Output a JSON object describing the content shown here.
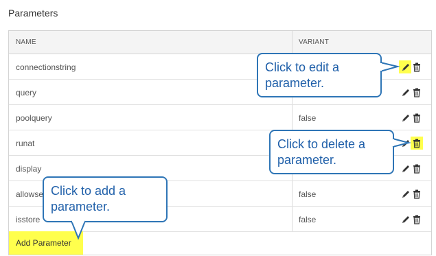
{
  "page": {
    "title": "Parameters"
  },
  "table": {
    "columns": [
      "NAME",
      "VARIANT"
    ],
    "rows": [
      {
        "name": "connectionstring",
        "variant": ""
      },
      {
        "name": "query",
        "variant": ""
      },
      {
        "name": "poolquery",
        "variant": "false"
      },
      {
        "name": "runat",
        "variant": ""
      },
      {
        "name": "display",
        "variant": ""
      },
      {
        "name": "allowse",
        "variant": "false"
      },
      {
        "name": "isstore",
        "variant": "false"
      }
    ],
    "add_label": "Add Parameter"
  },
  "callouts": {
    "edit": "Click to edit a parameter.",
    "delete": "Click to delete a parameter.",
    "add": "Click to add a parameter."
  },
  "colors": {
    "highlight": "#ffff4d",
    "callout_border": "#2e75b6",
    "callout_text": "#1f5fa9"
  }
}
